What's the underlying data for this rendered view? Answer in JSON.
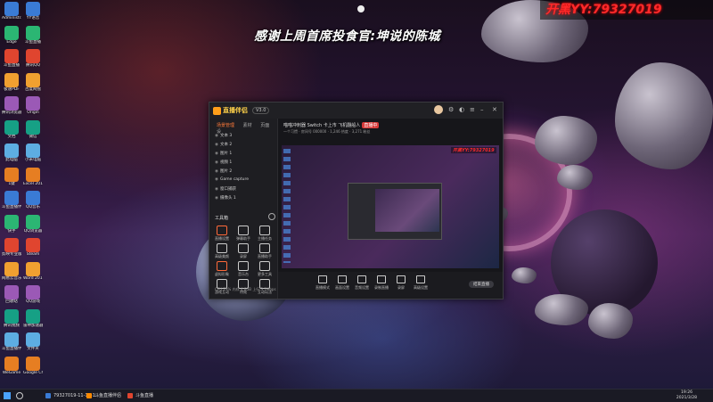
{
  "overlay": {
    "caption": "感谢上周首席投食官:坤说的陈城",
    "yy_id": "开黑YY:79327019"
  },
  "desktop_icons": [
    {
      "label": "Administr..."
    },
    {
      "label": "Edge"
    },
    {
      "label": "斗鱼直播"
    },
    {
      "label": "极速PDF"
    },
    {
      "label": "腾讯浏览器"
    },
    {
      "label": "文档"
    },
    {
      "label": "此电脑"
    },
    {
      "label": "1键"
    },
    {
      "label": "斗鱼直播伴侣"
    },
    {
      "label": "快手"
    },
    {
      "label": "剪映专业版"
    },
    {
      "label": "网易云音乐"
    },
    {
      "label": "回收站"
    },
    {
      "label": "腾讯视频"
    },
    {
      "label": "斗鱼直播伴侣"
    },
    {
      "label": "WeGame"
    },
    {
      "label": "YY语音"
    },
    {
      "label": "斗鱼直播"
    },
    {
      "label": "腾讯QQ"
    },
    {
      "label": "百度网盘"
    },
    {
      "label": "Origin"
    },
    {
      "label": "微信"
    },
    {
      "label": "小米电脑"
    },
    {
      "label": "Excel 2016"
    },
    {
      "label": "QQ音乐"
    },
    {
      "label": "QQ浏览器"
    },
    {
      "label": "Steam"
    },
    {
      "label": "Word 2016"
    },
    {
      "label": "QQ游戏"
    },
    {
      "label": "雷神加速器"
    },
    {
      "label": "文件夹"
    },
    {
      "label": "Google Chrome"
    }
  ],
  "app": {
    "name": "直播伴侣",
    "version": "V3.0",
    "tabs": [
      "场景管理",
      "素材",
      "页面设"
    ],
    "scenes": [
      "文本 3",
      "文本 2",
      "图片 1",
      "视频 1",
      "图片 2",
      "Game capture",
      "窗口捕获",
      "摄像头 1"
    ],
    "tools_title": "工具箱",
    "tools": [
      "直播设置",
      "弹幕助手",
      "主播任务",
      "高级美颜",
      "录屏",
      "直播助手",
      "虚拟形象",
      "音乐台",
      "更多工具",
      "游戏互动",
      "特效",
      "互动玩法"
    ],
    "stream_title": "喵喵冲刺器 Switch 卡上市 飞机翻船人",
    "stream_live_badge": "直播中",
    "stream_sub": "一个习惯 ·  房间号 000000 ·  1,246 热度 ·  3,271 粉丝",
    "bottom_buttons": [
      "直播模式",
      "画面设置",
      "音频设置",
      "录制直播",
      "录屏",
      "高级设置"
    ],
    "start_live": "结束直播",
    "status_line": "CPU 23%  内存 4.6GB  上行 3.1Mbps"
  },
  "taskbar": {
    "items": [
      {
        "label": "79327019-11-14-1...",
        "color": "#3a7bd5"
      },
      {
        "label": "斗鱼直播伴侣",
        "color": "#ff8a00"
      },
      {
        "label": "斗鱼直播",
        "color": "#e0452f"
      }
    ],
    "time": "19:26",
    "date": "2021/3/28"
  }
}
